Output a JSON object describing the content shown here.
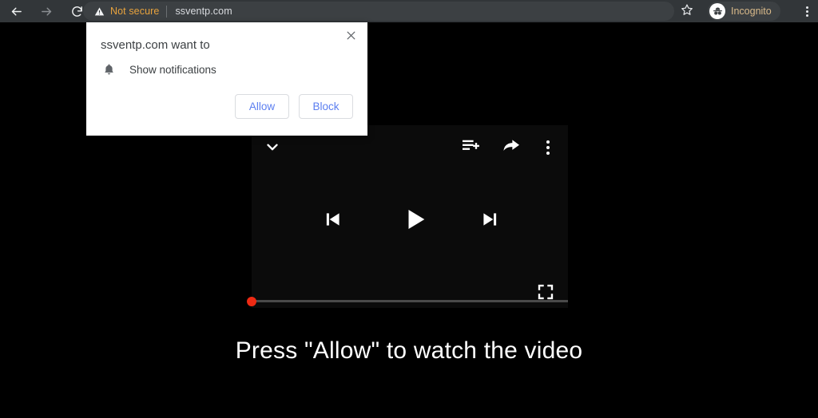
{
  "browser": {
    "toolbar": {
      "back_icon": "arrow-left-icon",
      "forward_icon": "arrow-right-icon",
      "reload_icon": "reload-icon",
      "bookmark_icon": "star-icon",
      "menu_icon": "kebab-menu-icon"
    },
    "omnibox": {
      "security_icon": "warning-triangle-icon",
      "security_label": "Not secure",
      "url": "ssventp.com"
    },
    "profile": {
      "label": "Incognito",
      "avatar_icon": "incognito-spy-icon"
    }
  },
  "dialog": {
    "title": "ssventp.com want to",
    "close_icon": "close-x-icon",
    "permission": {
      "icon": "bell-icon",
      "label": "Show notifications"
    },
    "allow_label": "Allow",
    "block_label": "Block"
  },
  "player": {
    "collapse_icon": "chevron-down-icon",
    "queue_icon": "add-to-queue-icon",
    "share_icon": "share-arrow-icon",
    "menu_icon": "kebab-menu-icon",
    "previous_icon": "skip-previous-icon",
    "play_icon": "play-icon",
    "next_icon": "skip-next-icon",
    "fullscreen_icon": "fullscreen-icon",
    "progress_percent": 0
  },
  "page": {
    "cta_text": "Press \"Allow\" to watch the video"
  },
  "colors": {
    "toolbar_bg": "#323639",
    "omnibox_bg": "#3c4043",
    "not_secure": "#e8a33d",
    "incognito_text": "#d8b98a",
    "page_bg": "#000000",
    "player_bg": "#0b0b0b",
    "dialog_bg": "#ffffff",
    "dialog_button_text": "#5b7ef0",
    "scrubber": "#ee2a13",
    "progress_track": "#4a4a4a"
  }
}
